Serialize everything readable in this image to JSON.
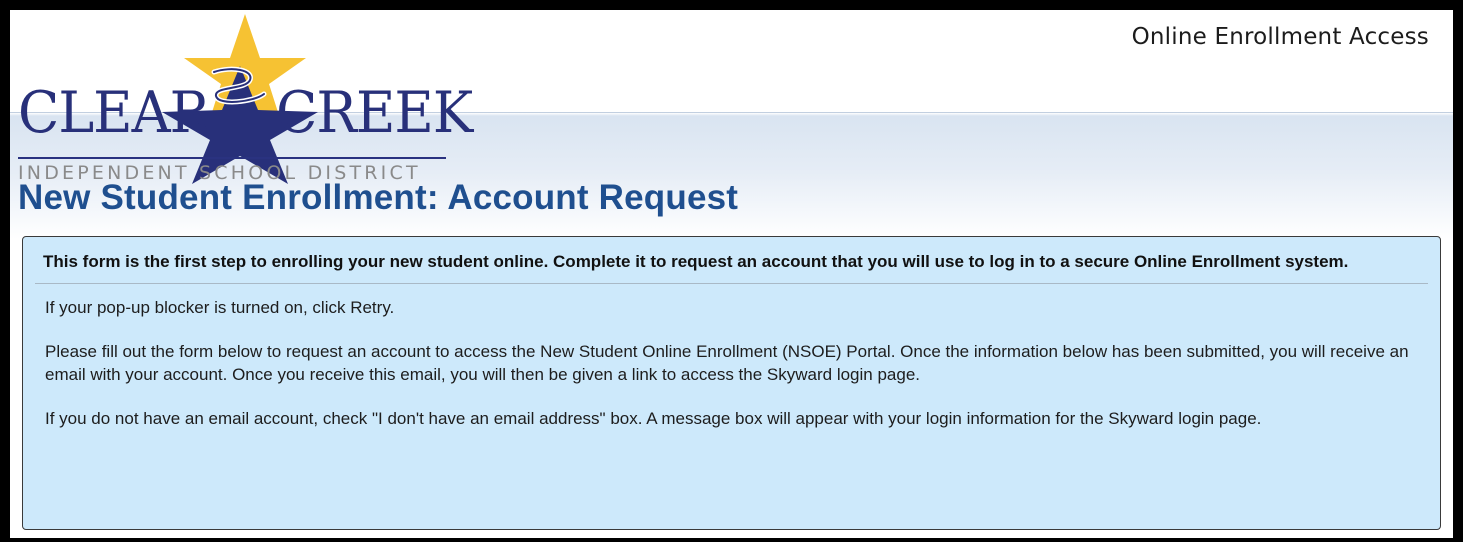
{
  "header": {
    "app_title": "Online Enrollment Access"
  },
  "logo": {
    "word_left": "CLEAR",
    "word_right": "CREEK",
    "subtitle": "INDEPENDENT SCHOOL DISTRICT",
    "colors": {
      "navy": "#28307a",
      "star_gold": "#f6c233",
      "subtitle_gray": "#8a8a8a"
    }
  },
  "page": {
    "title": "New Student Enrollment: Account Request"
  },
  "panel": {
    "heading": "This form is the first step to enrolling your new student online. Complete it to request an account that you will use to log in to a secure Online Enrollment system.",
    "paragraphs": [
      "If your pop-up blocker is turned on, click Retry.",
      "Please fill out the form below to request an account to access the New Student Online Enrollment (NSOE) Portal. Once the information below has been submitted, you will receive an email with your account. Once you receive this email, you will then be given a link to access the Skyward login page.",
      "If you do not have an email account, check \"I don't have an email address\" box. A message box will appear with your login information for the Skyward login page."
    ],
    "background_color": "#cde9fb"
  }
}
